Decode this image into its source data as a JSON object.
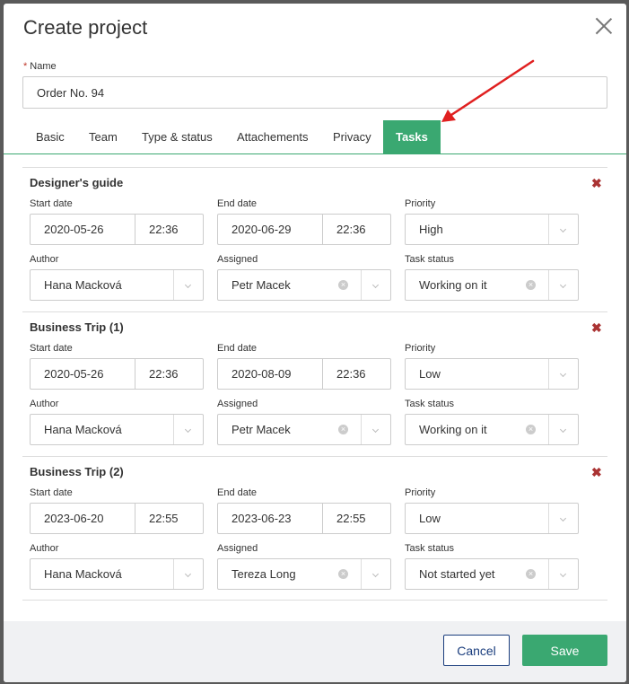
{
  "modal": {
    "title": "Create project"
  },
  "name_field": {
    "required_mark": "*",
    "label": "Name",
    "value": "Order No. 94"
  },
  "tabs": [
    {
      "label": "Basic"
    },
    {
      "label": "Team"
    },
    {
      "label": "Type & status"
    },
    {
      "label": "Attachements"
    },
    {
      "label": "Privacy"
    },
    {
      "label": "Tasks",
      "active": true
    }
  ],
  "labels": {
    "start_date": "Start date",
    "end_date": "End date",
    "priority": "Priority",
    "author": "Author",
    "assigned": "Assigned",
    "task_status": "Task status"
  },
  "tasks": [
    {
      "title": "Designer's guide",
      "start_date": "2020-05-26",
      "start_time": "22:36",
      "end_date": "2020-06-29",
      "end_time": "22:36",
      "priority": "High",
      "author": "Hana Macková",
      "assigned": "Petr Macek",
      "status": "Working on it"
    },
    {
      "title": "Business Trip (1)",
      "start_date": "2020-05-26",
      "start_time": "22:36",
      "end_date": "2020-08-09",
      "end_time": "22:36",
      "priority": "Low",
      "author": "Hana Macková",
      "assigned": "Petr Macek",
      "status": "Working on it"
    },
    {
      "title": "Business Trip (2)",
      "start_date": "2023-06-20",
      "start_time": "22:55",
      "end_date": "2023-06-23",
      "end_time": "22:55",
      "priority": "Low",
      "author": "Hana Macková",
      "assigned": "Tereza Long",
      "status": "Not started yet"
    }
  ],
  "footer": {
    "cancel_label": "Cancel",
    "save_label": "Save"
  },
  "colors": {
    "accent": "#3aa871",
    "cancel_border": "#1a3d7d",
    "remove": "#aa3333",
    "arrow": "#e02020"
  }
}
